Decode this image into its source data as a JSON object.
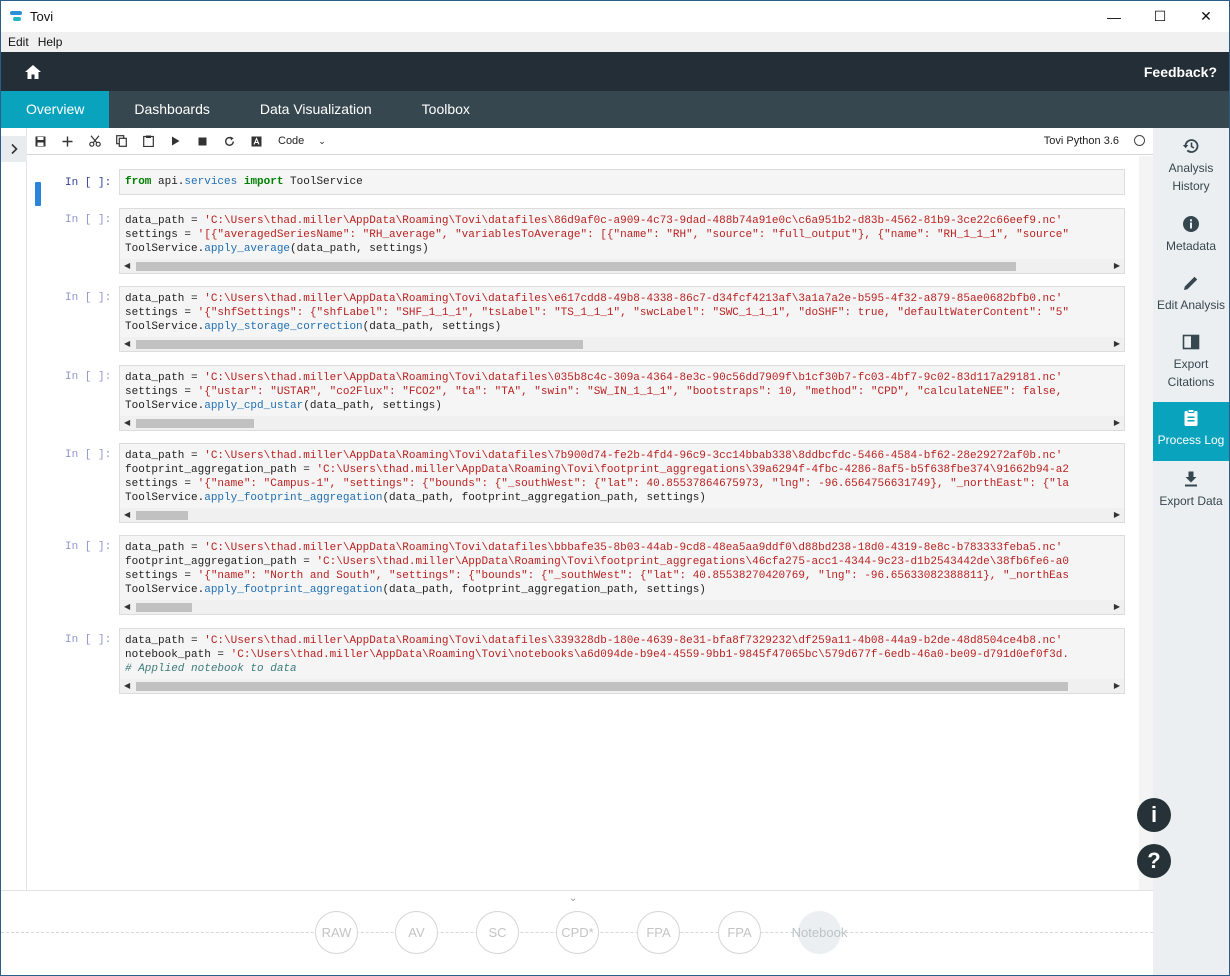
{
  "window": {
    "title": "Tovi",
    "minimize_glyph": "—",
    "maximize_glyph": "☐",
    "close_glyph": "✕"
  },
  "menu": [
    "Edit",
    "Help"
  ],
  "header": {
    "feedback": "Feedback?"
  },
  "tabs": [
    "Overview",
    "Dashboards",
    "Data Visualization",
    "Toolbox"
  ],
  "toolbar": {
    "cell_type": "Code",
    "kernel": "Tovi Python 3.6"
  },
  "prompts": {
    "empty": "In [ ]:"
  },
  "cells": [
    {
      "lines": [
        "from api.services import ToolService"
      ]
    },
    {
      "lines": [
        "data_path = 'C:\\Users\\thad.miller\\AppData\\Roaming\\Tovi\\datafiles\\86d9af0c-a909-4c73-9dad-488b74a91e0c\\c6a951b2-d83b-4562-81b9-3ce22c66eef9.nc'",
        "settings = '[{\"averagedSeriesName\": \"RH_average\", \"variablesToAverage\": [{\"name\": \"RH\", \"source\": \"full_output\"}, {\"name\": \"RH_1_1_1\", \"source\"",
        "ToolService.apply_average(data_path, settings)"
      ]
    },
    {
      "lines": [
        "data_path = 'C:\\Users\\thad.miller\\AppData\\Roaming\\Tovi\\datafiles\\e617cdd8-49b8-4338-86c7-d34fcf4213af\\3a1a7a2e-b595-4f32-a879-85ae0682bfb0.nc'",
        "settings = '{\"shfSettings\": {\"shfLabel\": \"SHF_1_1_1\", \"tsLabel\": \"TS_1_1_1\", \"swcLabel\": \"SWC_1_1_1\", \"doSHF\": true, \"defaultWaterContent\": \"5\"",
        "ToolService.apply_storage_correction(data_path, settings)"
      ]
    },
    {
      "lines": [
        "data_path = 'C:\\Users\\thad.miller\\AppData\\Roaming\\Tovi\\datafiles\\035b8c4c-309a-4364-8e3c-90c56dd7909f\\b1cf30b7-fc03-4bf7-9c02-83d117a29181.nc'",
        "settings = '{\"ustar\": \"USTAR\", \"co2Flux\": \"FCO2\", \"ta\": \"TA\", \"swin\": \"SW_IN_1_1_1\", \"bootstraps\": 10, \"method\": \"CPD\", \"calculateNEE\": false,",
        "ToolService.apply_cpd_ustar(data_path, settings)"
      ]
    },
    {
      "lines": [
        "data_path = 'C:\\Users\\thad.miller\\AppData\\Roaming\\Tovi\\datafiles\\7b900d74-fe2b-4fd4-96c9-3cc14bbab338\\8ddbcfdc-5466-4584-bf62-28e29272af0b.nc'",
        "footprint_aggregation_path = 'C:\\Users\\thad.miller\\AppData\\Roaming\\Tovi\\footprint_aggregations\\39a6294f-4fbc-4286-8af5-b5f638fbe374\\91662b94-a2",
        "settings = '{\"name\": \"Campus-1\", \"settings\": {\"bounds\": {\"_southWest\": {\"lat\": 40.85537864675973, \"lng\": -96.6564756631749}, \"_northEast\": {\"la",
        "ToolService.apply_footprint_aggregation(data_path, footprint_aggregation_path, settings)"
      ]
    },
    {
      "lines": [
        "data_path = 'C:\\Users\\thad.miller\\AppData\\Roaming\\Tovi\\datafiles\\bbbafe35-8b03-44ab-9cd8-48ea5aa9ddf0\\d88bd238-18d0-4319-8e8c-b783333feba5.nc'",
        "footprint_aggregation_path = 'C:\\Users\\thad.miller\\AppData\\Roaming\\Tovi\\footprint_aggregations\\46cfa275-acc1-4344-9c23-d1b2543442de\\38fb6fe6-a0",
        "settings = '{\"name\": \"North and South\", \"settings\": {\"bounds\": {\"_southWest\": {\"lat\": 40.85538270420769, \"lng\": -96.65633082388811}, \"_northEas",
        "ToolService.apply_footprint_aggregation(data_path, footprint_aggregation_path, settings)"
      ]
    },
    {
      "lines": [
        "data_path = 'C:\\Users\\thad.miller\\AppData\\Roaming\\Tovi\\datafiles\\339328db-180e-4639-8e31-bfa8f7329232\\df259a11-4b08-44a9-b2de-48d8504ce4b8.nc'",
        "notebook_path = 'C:\\Users\\thad.miller\\AppData\\Roaming\\Tovi\\notebooks\\a6d094de-b9e4-4559-9bb1-9845f47065bc\\579d677f-6edb-46a0-be09-d791d0ef0f3d.",
        "# Applied notebook to data"
      ]
    }
  ],
  "sidebar": [
    {
      "label_lines": [
        "Analysis",
        "History"
      ],
      "icon": "history-icon",
      "active": false
    },
    {
      "label_lines": [
        "Metadata"
      ],
      "icon": "info-icon",
      "active": false
    },
    {
      "label_lines": [
        "Edit Analysis"
      ],
      "icon": "pencil-icon",
      "active": false
    },
    {
      "label_lines": [
        "Export",
        "Citations"
      ],
      "icon": "book-icon",
      "active": false
    },
    {
      "label_lines": [
        "Process Log"
      ],
      "icon": "clipboard-icon",
      "active": true
    },
    {
      "label_lines": [
        "Export Data"
      ],
      "icon": "download-icon",
      "active": false
    }
  ],
  "fabs": {
    "info": "i",
    "help": "?"
  },
  "pipeline": [
    "RAW",
    "AV",
    "SC",
    "CPD*",
    "FPA",
    "FPA",
    "Notebook"
  ],
  "colors": {
    "accent": "#0aa3be",
    "header": "#232e36",
    "nav": "#37474f",
    "prompt": "#303f9f"
  }
}
